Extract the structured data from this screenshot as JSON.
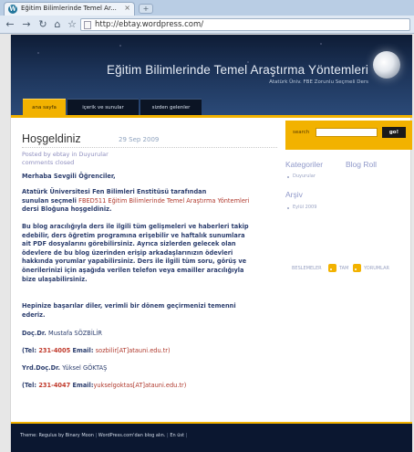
{
  "browser": {
    "tab_title": "Eğitim Bilimlerinde Temel Ar...",
    "tab_close": "×",
    "url": "http://ebtay.wordpress.com/"
  },
  "blog": {
    "title": "Eğitim Bilimlerinde Temel Araştırma Yöntemleri",
    "description": "Atatürk Üniv. FBE Zorunlu Seçmeli Ders",
    "nav": [
      "ana sayfa",
      "içerik ve sunular",
      "sizden gelenler"
    ],
    "nav_active": 0
  },
  "post": {
    "title": "Hoşgeldiniz",
    "date": "29 Sep 2009",
    "posted_by": "Posted by ebtay in Duyurular",
    "comments": "comments closed",
    "greeting": "Merhaba Sevgili Öğrenciler,",
    "p1_line1": "Atatürk Üniversitesi Fen Bilimleri Enstitüsü tarafından",
    "p1_line2_prefix": "sunulan seçmeli ",
    "p1_link": "FBED511 Eğitim Bilimlerinde Temel Araştırma Yöntemleri",
    "p1_line3": "dersi Bloğuna hoşgeldiniz.",
    "p2_lines": [
      "Bu blog aracılığıyla ders ile ilgili tüm gelişmeleri ve haberleri takip",
      "edebilir, ders öğretim programına erişebilir ve haftalık sunumlara",
      "ait PDF dosyalarını görebilirsiniz. Ayrıca sizlerden gelecek olan",
      "ödevlere de bu blog üzerinden erişip arkadaşlarınızın ödevleri",
      "hakkında yorumlar yapabilirsiniz. Ders ile ilgili tüm soru, görüş ve",
      "önerilerinizi için aşağıda verilen telefon veya emailler aracılığıyla",
      "bize ulaşabilirsiniz."
    ],
    "p3_lines": [
      "Hepinize başarılar diler, verimli bir dönem geçirmenizi temenni",
      "ederiz."
    ],
    "contact1_title": "Doç.Dr.",
    "contact1_name": "Mustafa SÖZBİLİR",
    "contact1_tel_label": "(Tel:",
    "contact1_tel": "231-4005",
    "contact1_email_label": "Email:",
    "contact1_email": "sozbilir[AT]atauni.edu.tr)",
    "contact2_title": "Yrd.Doç.Dr.",
    "contact2_name": "Yüksel GÖKTAŞ",
    "contact2_tel_label": "(Tel:",
    "contact2_tel": "231-4047",
    "contact2_email_label": "Email:",
    "contact2_email": "yukselgoktas[AT]atauni.edu.tr)"
  },
  "sidebar": {
    "search_label": "search",
    "search_button": "go!",
    "categories_heading": "Kategoriler",
    "categories": [
      "Duyurular"
    ],
    "blogroll_heading": "Blog Roll",
    "archive_heading": "Arşiv",
    "archive": [
      "Eylül 2009"
    ],
    "feeds_label": "BESLEMELER",
    "feed_all": "TAM",
    "feed_comments": "YORUMLAR"
  },
  "footer": {
    "theme": "Theme: Regulus by Binary Moon",
    "wordpress": "WordPress.com'dan blog alın.",
    "top": "En üst"
  },
  "colors": {
    "accent": "#f2b200",
    "header_dark": "#0e1c35",
    "link_red": "#c0392b",
    "text_blue": "#2c3e6e"
  }
}
